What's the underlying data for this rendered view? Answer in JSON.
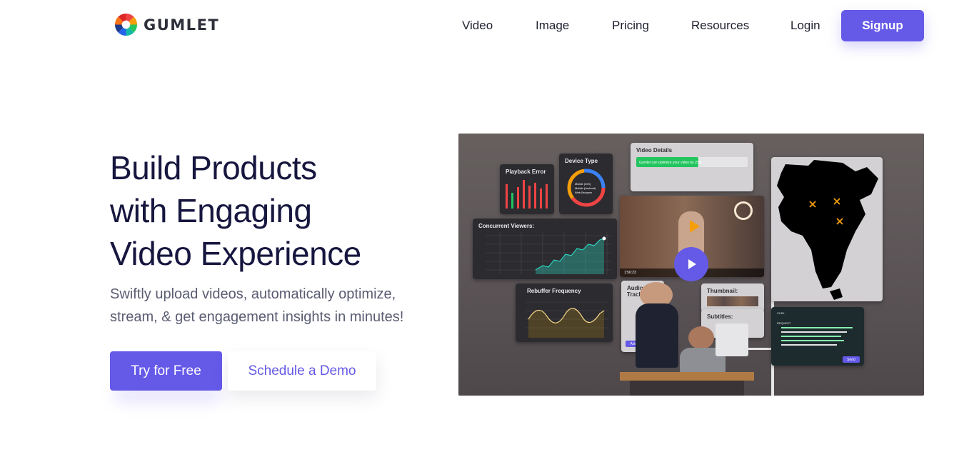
{
  "brand": {
    "name": "GUMLET"
  },
  "nav": {
    "links": [
      "Video",
      "Image",
      "Pricing",
      "Resources",
      "Login"
    ],
    "signup_label": "Signup"
  },
  "hero": {
    "headline_line1": "Build Products",
    "headline_line2_prefix": "with ",
    "headline_line2_highlight": "Engaging",
    "headline_line3": "Video Experience",
    "subhead": "Swiftly upload videos, automatically optimize, stream, & get engagement insights in minutes!",
    "cta_primary": "Try for Free",
    "cta_secondary": "Schedule a Demo"
  },
  "visual": {
    "cards": {
      "playback_error": "Playback Error",
      "device_type": "Device Type",
      "video_details": "Video Details",
      "video_details_note": "Gumlet can optimize your video by 23%",
      "concurrent_viewers": "Concurrent Viewers:",
      "rebuffer_frequency": "Rebuffer Frequency",
      "audio_tracks": "Audio Tracks:",
      "thumbnail": "Thumbnail:",
      "subtitles": "Subtitles:",
      "audio_add": "Add",
      "code_send": "Send",
      "code_label": "CURL",
      "code_request": "REQUEST",
      "player_time": "1:56:23"
    },
    "device_legend": [
      "Mobile (iOS)",
      "Mobile (Android)",
      "Web Browser"
    ],
    "colors": {
      "accent": "#6559e8",
      "green": "#22c55e",
      "orange": "#f59e0b",
      "map": "#000000"
    }
  }
}
